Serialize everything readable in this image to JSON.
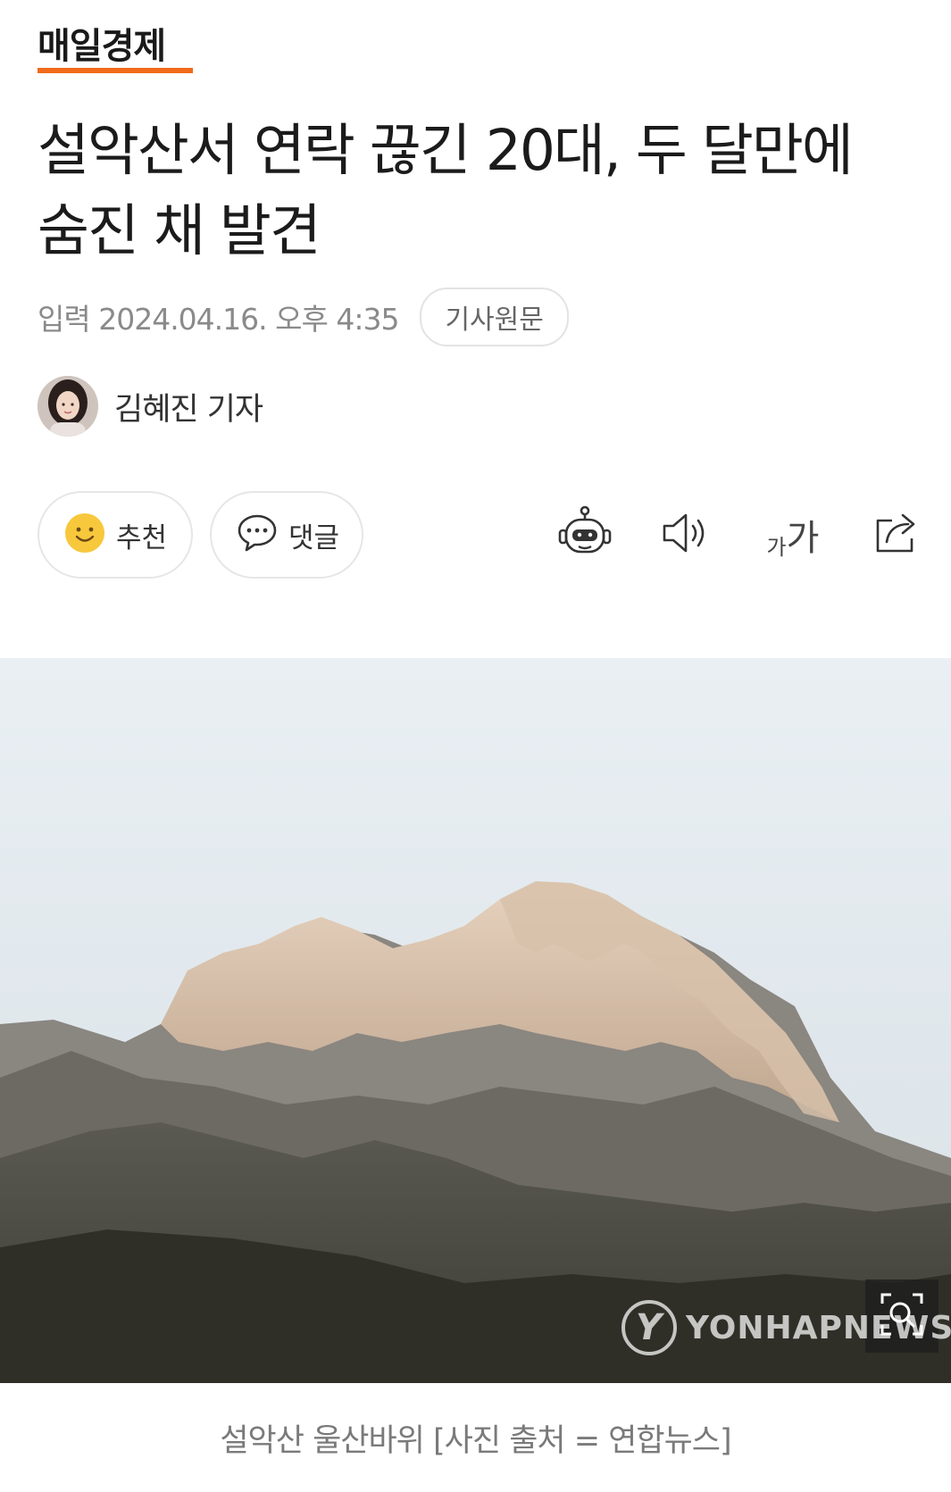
{
  "brand": {
    "name": "매일경제",
    "accent": "#f26a1b"
  },
  "article": {
    "title": "설악산서 연락 끊긴 20대, 두 달만에 숨진 채 발견",
    "date": "입력 2024.04.16. 오후 4:35",
    "source_button": "기사원문",
    "author": "김혜진 기자"
  },
  "actions": {
    "recommend": {
      "label": "추천",
      "icon": "smiley-icon"
    },
    "comment": {
      "label": "댓글",
      "icon": "speech-bubble-icon"
    },
    "tools": [
      "robot-summary-icon",
      "speaker-icon",
      "font-size-icon",
      "share-icon"
    ],
    "font_small": "가",
    "font_big": "가"
  },
  "photo": {
    "description_icon": "zoom-icon",
    "watermark": "YONHAPNEWS",
    "watermark_logo": "Y",
    "caption": "설악산 울산바위 [사진 출처 = 연합뉴스]"
  }
}
